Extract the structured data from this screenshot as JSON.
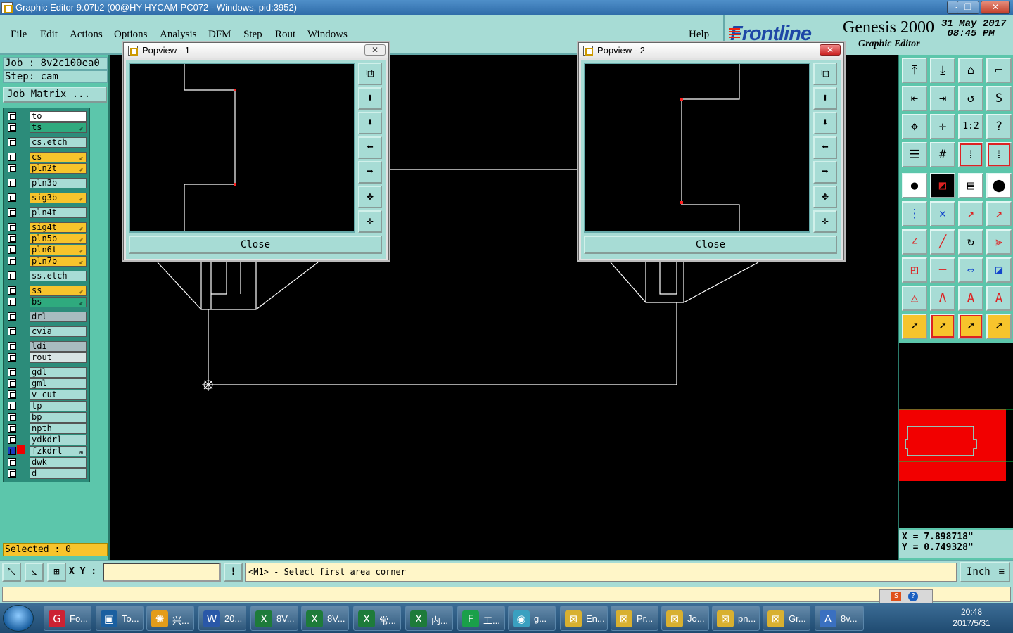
{
  "window": {
    "title": "Graphic Editor 9.07b2 (00@HY-HYCAM-PC072 - Windows, pid:3952)",
    "min": "—",
    "max": "❐",
    "close": "✕"
  },
  "menu": {
    "items": [
      "File",
      "Edit",
      "Actions",
      "Options",
      "Analysis",
      "DFM",
      "Step",
      "Rout",
      "Windows"
    ],
    "help": "Help"
  },
  "brand": {
    "logo": "Frontline",
    "product": "Genesis 2000",
    "subtitle": "Graphic Editor",
    "date": "31 May 2017",
    "time": "08:45 PM"
  },
  "job": {
    "job_line": "Job : 8v2c100ea0",
    "step_line": "Step: cam",
    "matrix_button": "Job Matrix ..."
  },
  "layers": [
    {
      "name": "to",
      "color": "#ffffff",
      "flag": ""
    },
    {
      "name": "ts",
      "color": "#2faa7e",
      "flag": "✐"
    },
    {
      "name": "cs.etch",
      "color": "#a7dcd5",
      "flag": ""
    },
    {
      "name": "cs",
      "color": "#f7c42c",
      "flag": "✐"
    },
    {
      "name": "pln2t",
      "color": "#f7c42c",
      "flag": "✐"
    },
    {
      "name": "pln3b",
      "color": "#a7dcd5",
      "flag": ""
    },
    {
      "name": "sig3b",
      "color": "#f7c42c",
      "flag": "✐"
    },
    {
      "name": "pln4t",
      "color": "#a7dcd5",
      "flag": ""
    },
    {
      "name": "sig4t",
      "color": "#f7c42c",
      "flag": "✐"
    },
    {
      "name": "pln5b",
      "color": "#f7c42c",
      "flag": "✐"
    },
    {
      "name": "pln6t",
      "color": "#f7c42c",
      "flag": "✐"
    },
    {
      "name": "pln7b",
      "color": "#f7c42c",
      "flag": "✐"
    },
    {
      "name": "ss.etch",
      "color": "#a7dcd5",
      "flag": ""
    },
    {
      "name": "ss",
      "color": "#f7c42c",
      "flag": "✐"
    },
    {
      "name": "bs",
      "color": "#2faa7e",
      "flag": "✐"
    },
    {
      "name": "drl",
      "color": "#a8bcc0",
      "flag": ""
    },
    {
      "name": "cvia",
      "color": "#a7dcd5",
      "flag": ""
    },
    {
      "name": "ldi",
      "color": "#a8bcc0",
      "flag": ""
    },
    {
      "name": "rout",
      "color": "#d8e4e4",
      "flag": ""
    },
    {
      "name": "gdl",
      "color": "#a7dcd5",
      "flag": ""
    },
    {
      "name": "gml",
      "color": "#a7dcd5",
      "flag": ""
    },
    {
      "name": "v-cut",
      "color": "#a7dcd5",
      "flag": ""
    },
    {
      "name": "tp",
      "color": "#a7dcd5",
      "flag": ""
    },
    {
      "name": "bp",
      "color": "#a7dcd5",
      "flag": ""
    },
    {
      "name": "npth",
      "color": "#a7dcd5",
      "flag": ""
    },
    {
      "name": "ydkdrl",
      "color": "#a7dcd5",
      "flag": ""
    },
    {
      "name": "fzkdrl",
      "color": "#a7dcd5",
      "flag": "⊞"
    },
    {
      "name": "dwk",
      "color": "#a7dcd5",
      "flag": ""
    },
    {
      "name": "d",
      "color": "#a7dcd5",
      "flag": ""
    }
  ],
  "selected": "Selected : 0",
  "popview1": {
    "title": "Popview - 1",
    "close_label": "Close",
    "x": "✕"
  },
  "popview2": {
    "title": "Popview - 2",
    "close_label": "Close",
    "x": "✕"
  },
  "coords": {
    "x": "X = 7.898718\"",
    "y": "Y = 0.749328\""
  },
  "bottom": {
    "xy_label": "X Y :",
    "xy_value": "",
    "excl": "!",
    "prompt": "<M1> - Select first area corner",
    "unit": "Inch"
  },
  "taskbar": {
    "items": [
      "Fo...",
      "To...",
      "兴...",
      "20...",
      "8V...",
      "8V...",
      "常...",
      "内...",
      "工...",
      "g...",
      "En...",
      "Pr...",
      "Jo...",
      "pn...",
      "Gr...",
      "8v..."
    ],
    "time": "20:48",
    "date": "2017/5/31"
  }
}
